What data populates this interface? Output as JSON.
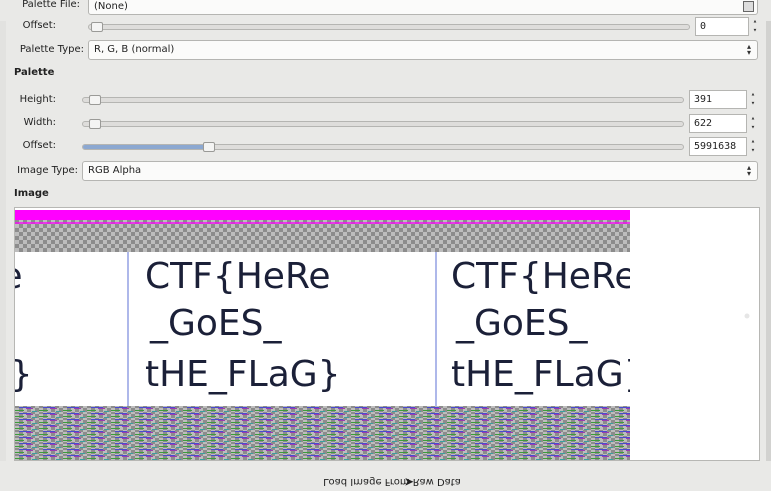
{
  "dialog": {
    "load_button_label": "Load Image From Raw Data"
  },
  "image_section": {
    "title": "Image",
    "image_type_label": "Image Type:",
    "image_type_value": "RGB Alpha",
    "offset_label": "Offset:",
    "offset_value": "5991638",
    "offset_fraction": 0.2,
    "width_label": "Width:",
    "width_value": "622",
    "width_fraction": 0.01,
    "height_label": "Height:",
    "height_value": "391",
    "height_fraction": 0.01
  },
  "palette_section": {
    "title": "Palette",
    "palette_type_label": "Palette Type:",
    "palette_type_value": "R, G, B (normal)",
    "offset_label": "Offset:",
    "offset_value": "0",
    "offset_fraction": 0.0,
    "palette_file_label": "Palette File:",
    "palette_file_value": "(None)"
  },
  "preview": {
    "text_lines": [
      "CTF{HeRe",
      "_GoES_",
      "tHE_FLaG}"
    ]
  },
  "colors": {
    "magenta": "#ff00ff",
    "accent": "#8ca8d1"
  }
}
